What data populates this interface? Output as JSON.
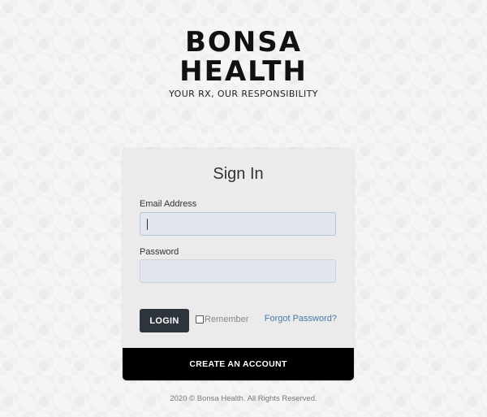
{
  "logo": {
    "line1": "BONSA",
    "line2": "HEALTH",
    "tagline": "YOUR RX, OUR RESPONSIBILITY"
  },
  "signin": {
    "title": "Sign In",
    "email_label": "Email Address",
    "email_value": "",
    "password_label": "Password",
    "password_value": "",
    "login_label": "LOGIN",
    "remember_label": "Remember",
    "forgot_label": "Forgot Password?",
    "create_account_label": "CREATE AN ACCOUNT"
  },
  "footer": {
    "text": "2020 © Bonsa Health. All Rights Reserved."
  }
}
